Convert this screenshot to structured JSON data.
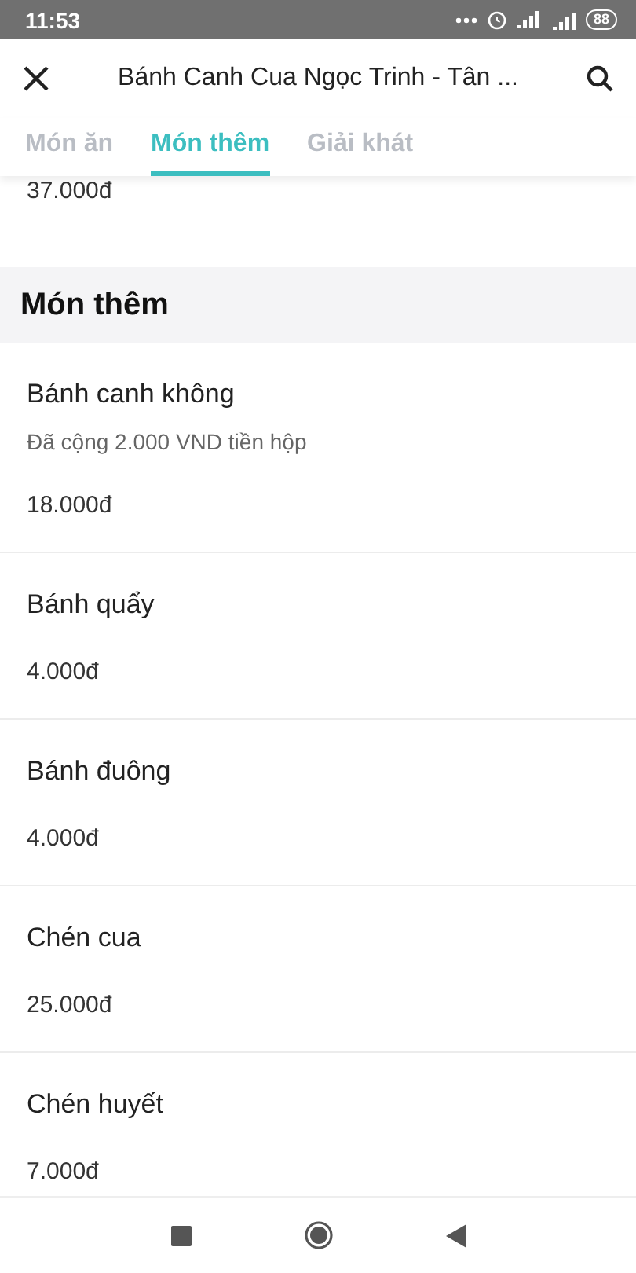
{
  "status_bar": {
    "time": "11:53",
    "battery": "88"
  },
  "header": {
    "title": "Bánh Canh Cua Ngọc Trinh - Tân ..."
  },
  "tabs": [
    {
      "label": "Món ăn",
      "selected": false
    },
    {
      "label": "Món thêm",
      "selected": true
    },
    {
      "label": "Giải khát",
      "selected": false
    }
  ],
  "previous_price": "37.000đ",
  "section": {
    "title": "Món thêm",
    "items": [
      {
        "name": "Bánh canh không",
        "note": "Đã cộng 2.000 VND tiền hộp",
        "price": "18.000đ"
      },
      {
        "name": "Bánh quẩy",
        "price": "4.000đ"
      },
      {
        "name": "Bánh đuông",
        "price": "4.000đ"
      },
      {
        "name": "Chén cua",
        "price": "25.000đ"
      },
      {
        "name": "Chén huyết",
        "price": "7.000đ"
      }
    ]
  }
}
